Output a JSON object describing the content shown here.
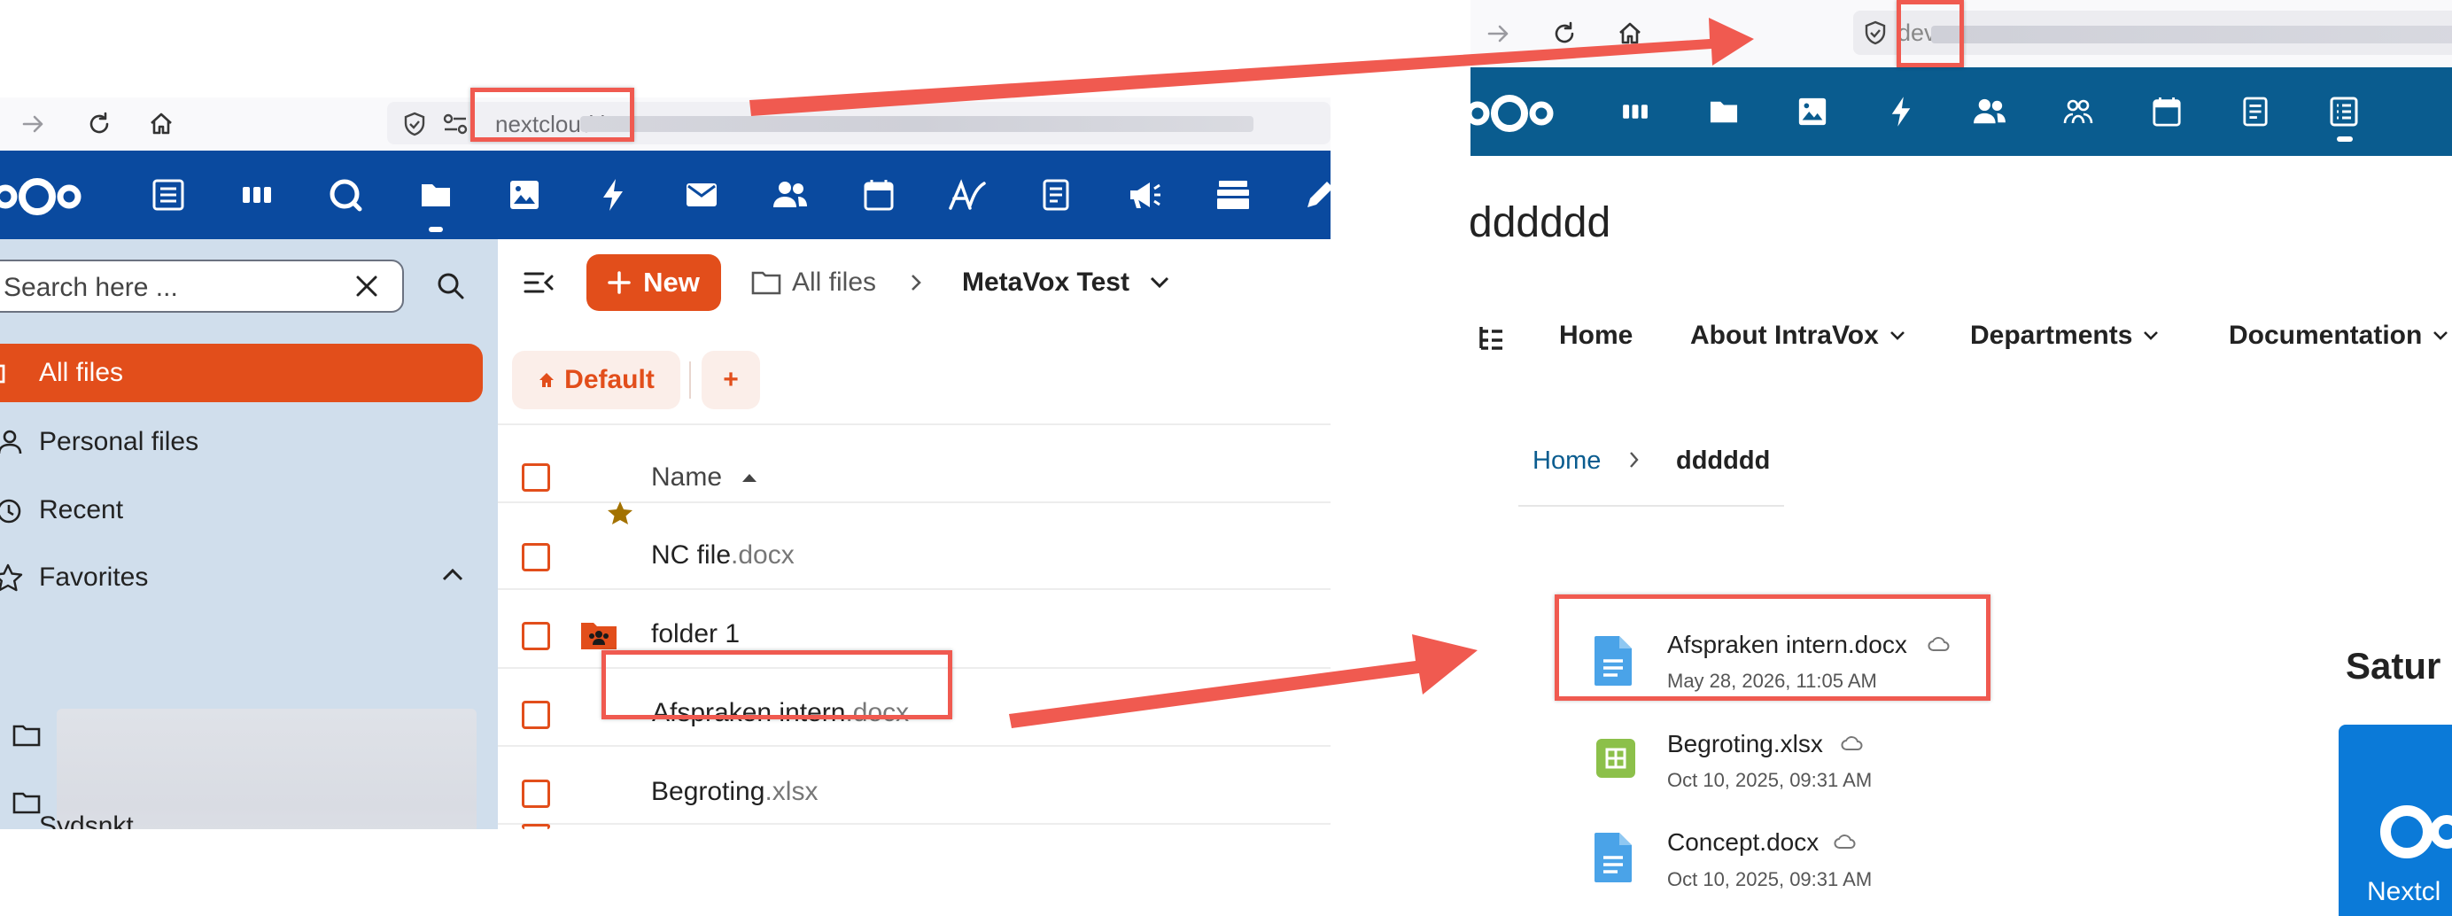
{
  "left": {
    "browser": {
      "url_text": "nextcloud.i"
    },
    "search": {
      "placeholder": "Search here ..."
    },
    "sidebar": {
      "items": [
        {
          "label": "All files"
        },
        {
          "label": "Personal files"
        },
        {
          "label": "Recent"
        },
        {
          "label": "Favorites"
        },
        {
          "label": "Sydsnkt..."
        }
      ]
    },
    "toolbar": {
      "new_label": "New",
      "breadcrumb_root": "All files",
      "breadcrumb_current": "MetaVox Test",
      "view_default_label": "Default",
      "add_view_label": "+"
    },
    "table": {
      "column_name": "Name",
      "rows": [
        {
          "base": "NC file",
          "ext": ".docx"
        },
        {
          "base": "folder 1",
          "ext": ""
        },
        {
          "base": "Afspraken intern",
          "ext": ".docx"
        },
        {
          "base": "Begroting",
          "ext": ".xlsx"
        }
      ]
    }
  },
  "right": {
    "browser": {
      "url_text": "dev"
    },
    "page_title": "dddddd",
    "menu": {
      "home": "Home",
      "about": "About IntraVox",
      "departments": "Departments",
      "documentation": "Documentation"
    },
    "breadcrumb": {
      "home": "Home",
      "current": "dddddd"
    },
    "files": [
      {
        "name": "Afspraken intern.docx",
        "date": "May 28, 2026, 11:05 AM",
        "type": "doc"
      },
      {
        "name": "Begroting.xlsx",
        "date": "Oct 10, 2025, 09:31 AM",
        "type": "sheet"
      },
      {
        "name": "Concept.docx",
        "date": "Oct 10, 2025, 09:31 AM",
        "type": "doc"
      }
    ],
    "side_heading": "Satur",
    "side_card_label": "Nextcl"
  },
  "colors": {
    "nextcloud_blue": "#0a4a9f",
    "intravox_blue": "#0a5c8f",
    "accent_orange": "#e24e1b",
    "annotation_red": "#f05a50"
  }
}
